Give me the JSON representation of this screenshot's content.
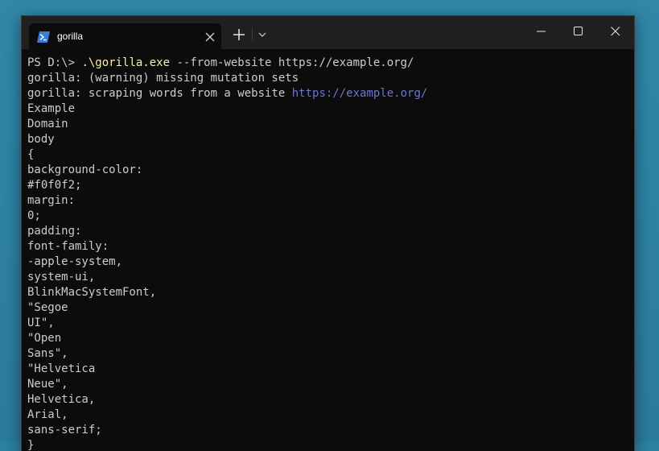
{
  "tab": {
    "title": "gorilla",
    "icon": "powershell-icon"
  },
  "window_controls": {
    "new_tab": "plus-icon",
    "dropdown": "chevron-down-icon",
    "minimize": "minimize-icon",
    "maximize": "maximize-icon",
    "close": "close-icon"
  },
  "colors": {
    "background": "#0c0c0c",
    "text": "#cccccc",
    "exe": "#f9f1a5",
    "url": "#6b75d8",
    "titlebar": "#202020"
  },
  "terminal": {
    "prompt": "PS D:\\> ",
    "command_exe": ".\\gorilla.exe",
    "command_args": " --from-website https://example.org/",
    "warning_line": "gorilla: (warning) missing mutation sets",
    "scrape_prefix": "gorilla: scraping words from a website ",
    "scrape_url": "https://example.org/",
    "output": [
      "Example",
      "Domain",
      "body",
      "{",
      "background-color:",
      "#f0f0f2;",
      "margin:",
      "0;",
      "padding:",
      "font-family:",
      "-apple-system,",
      "system-ui,",
      "BlinkMacSystemFont,",
      "\"Segoe",
      "UI\",",
      "\"Open",
      "Sans\",",
      "\"Helvetica",
      "Neue\",",
      "Helvetica,",
      "Arial,",
      "sans-serif;",
      "}"
    ]
  }
}
